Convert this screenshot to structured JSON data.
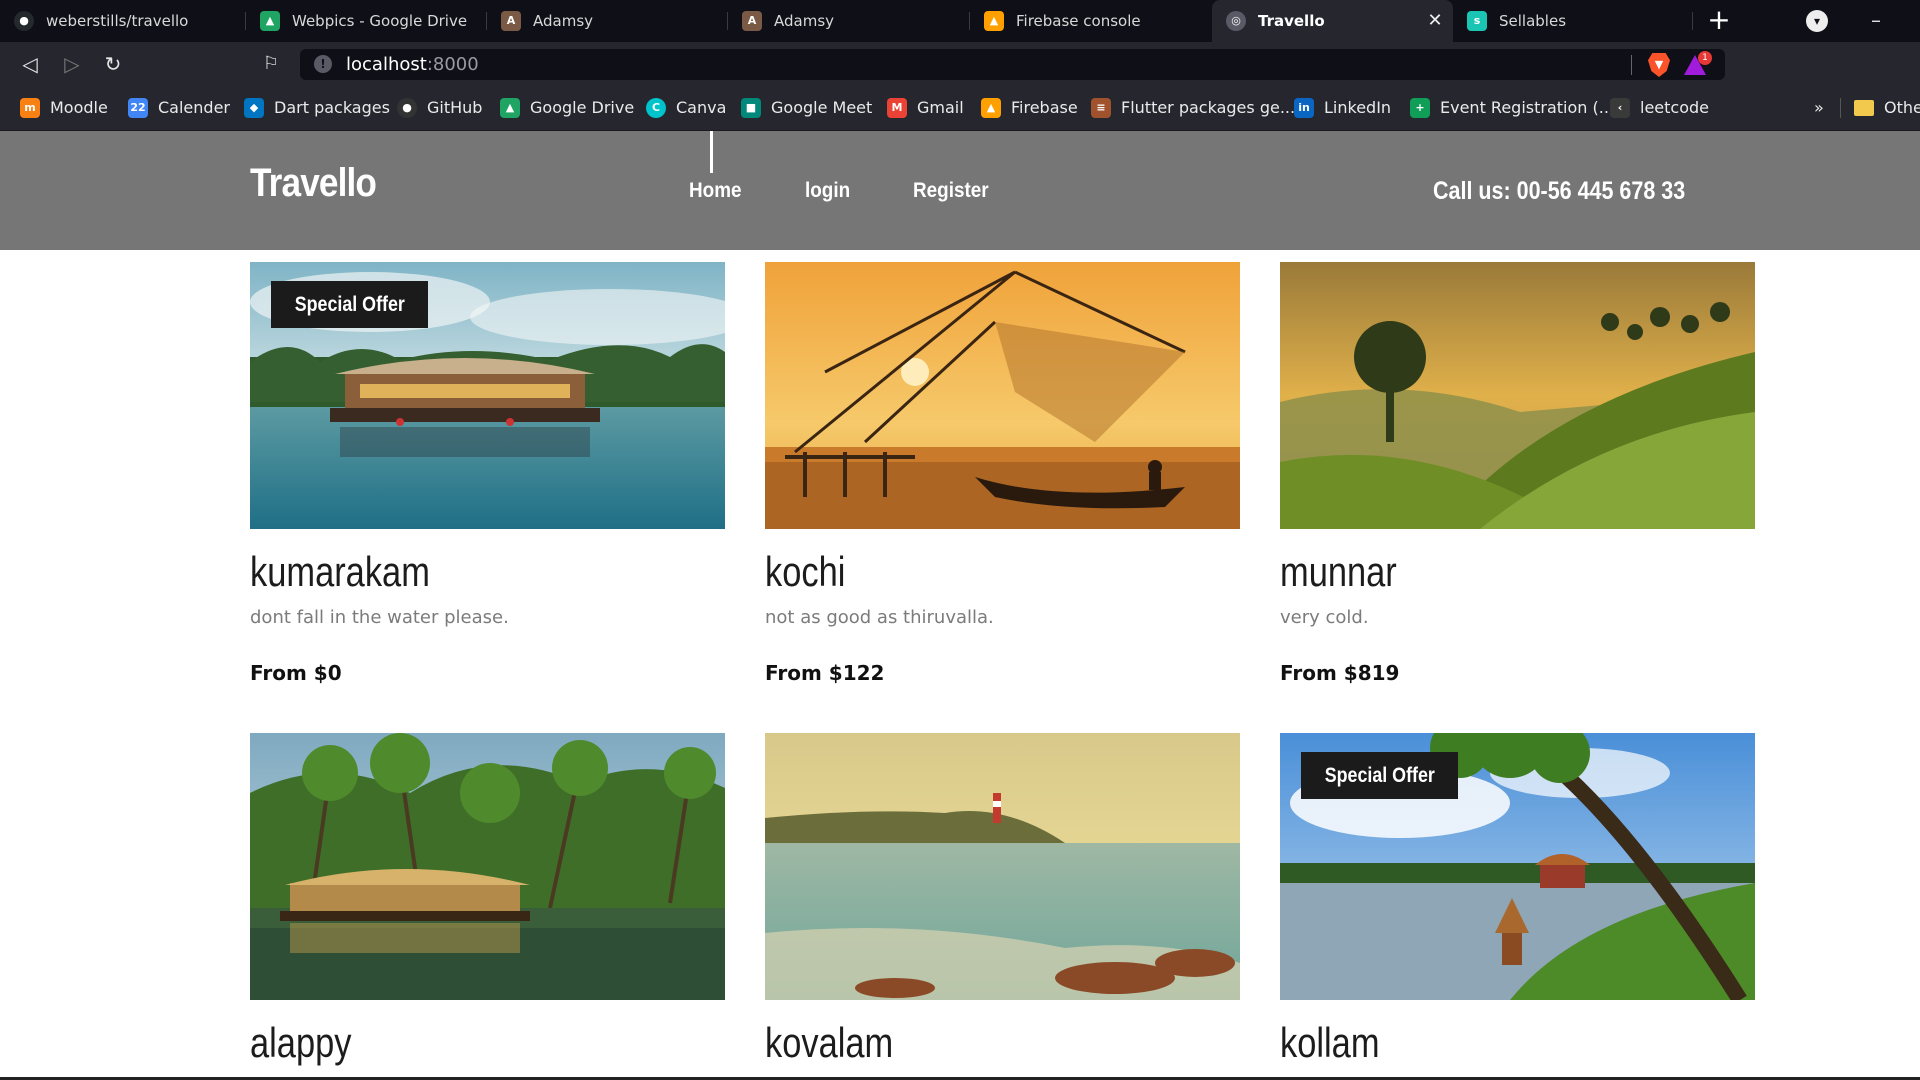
{
  "browser": {
    "tabs": [
      {
        "title": "weberstills/travello",
        "icon": "github-icon",
        "color": "#24292e"
      },
      {
        "title": "Webpics - Google Drive",
        "icon": "google-drive-icon",
        "color": "#1fa463"
      },
      {
        "title": "Adamsy",
        "icon": "adamsy-icon",
        "color": "#7a5a44"
      },
      {
        "title": "Adamsy",
        "icon": "adamsy-icon",
        "color": "#7a5a44"
      },
      {
        "title": "Firebase console",
        "icon": "firebase-icon",
        "color": "#ffa000"
      },
      {
        "title": "Travello",
        "icon": "globe-icon",
        "color": "#5a5a66",
        "active": true
      },
      {
        "title": "Sellables",
        "icon": "sellables-icon",
        "color": "#1bc5b4"
      }
    ],
    "address": {
      "host": "localhost",
      "port": ":8000"
    },
    "bookmarks": [
      {
        "label": "Moodle",
        "icon": "moodle-icon",
        "color": "#f98012",
        "glyph": "m"
      },
      {
        "label": "Calender",
        "icon": "calendar-icon",
        "color": "#4285f4",
        "glyph": "22"
      },
      {
        "label": "Dart packages",
        "icon": "dart-icon",
        "color": "#0175c2",
        "glyph": "◆"
      },
      {
        "label": "GitHub",
        "icon": "github-icon",
        "color": "#333333",
        "glyph": "●"
      },
      {
        "label": "Google Drive",
        "icon": "google-drive-icon",
        "color": "#1fa463",
        "glyph": "▲"
      },
      {
        "label": "Canva",
        "icon": "canva-icon",
        "color": "#00c4cc",
        "glyph": "C"
      },
      {
        "label": "Google Meet",
        "icon": "google-meet-icon",
        "color": "#00897b",
        "glyph": "■"
      },
      {
        "label": "Gmail",
        "icon": "gmail-icon",
        "color": "#ea4335",
        "glyph": "M"
      },
      {
        "label": "Firebase",
        "icon": "firebase-icon",
        "color": "#ffa000",
        "glyph": "▲"
      },
      {
        "label": "Flutter packages ge...",
        "icon": "flutter-icon",
        "color": "#a0522d",
        "glyph": "≡"
      },
      {
        "label": "LinkedIn",
        "icon": "linkedin-icon",
        "color": "#0a66c2",
        "glyph": "in"
      },
      {
        "label": "Event Registration (...",
        "icon": "forms-plus-icon",
        "color": "#0f9d58",
        "glyph": "+"
      },
      {
        "label": "leetcode",
        "icon": "leetcode-icon",
        "color": "#3a3a3a",
        "glyph": "‹"
      }
    ],
    "more_label": "»",
    "other_label": "Othe"
  },
  "site": {
    "logo": "Travello",
    "nav": [
      "Home",
      "login",
      "Register"
    ],
    "call": "Call us: 00-56 445 678 33",
    "offer_label": "Special Offer"
  },
  "destinations": [
    {
      "name": "kumarakam",
      "desc": "dont fall in the water please.",
      "price": "From $0",
      "offer": true,
      "scene": "houseboat-lake"
    },
    {
      "name": "kochi",
      "desc": "not as good as thiruvalla.",
      "price": "From $122",
      "offer": false,
      "scene": "fishing-nets-sunset"
    },
    {
      "name": "munnar",
      "desc": "very cold.",
      "price": "From $819",
      "offer": false,
      "scene": "tea-hills-sunset"
    },
    {
      "name": "alappy",
      "desc": "",
      "price": "",
      "offer": false,
      "scene": "palm-backwater"
    },
    {
      "name": "kovalam",
      "desc": "",
      "price": "",
      "offer": false,
      "scene": "lighthouse-beach"
    },
    {
      "name": "kollam",
      "desc": "",
      "price": "",
      "offer": true,
      "scene": "lake-palm"
    }
  ]
}
